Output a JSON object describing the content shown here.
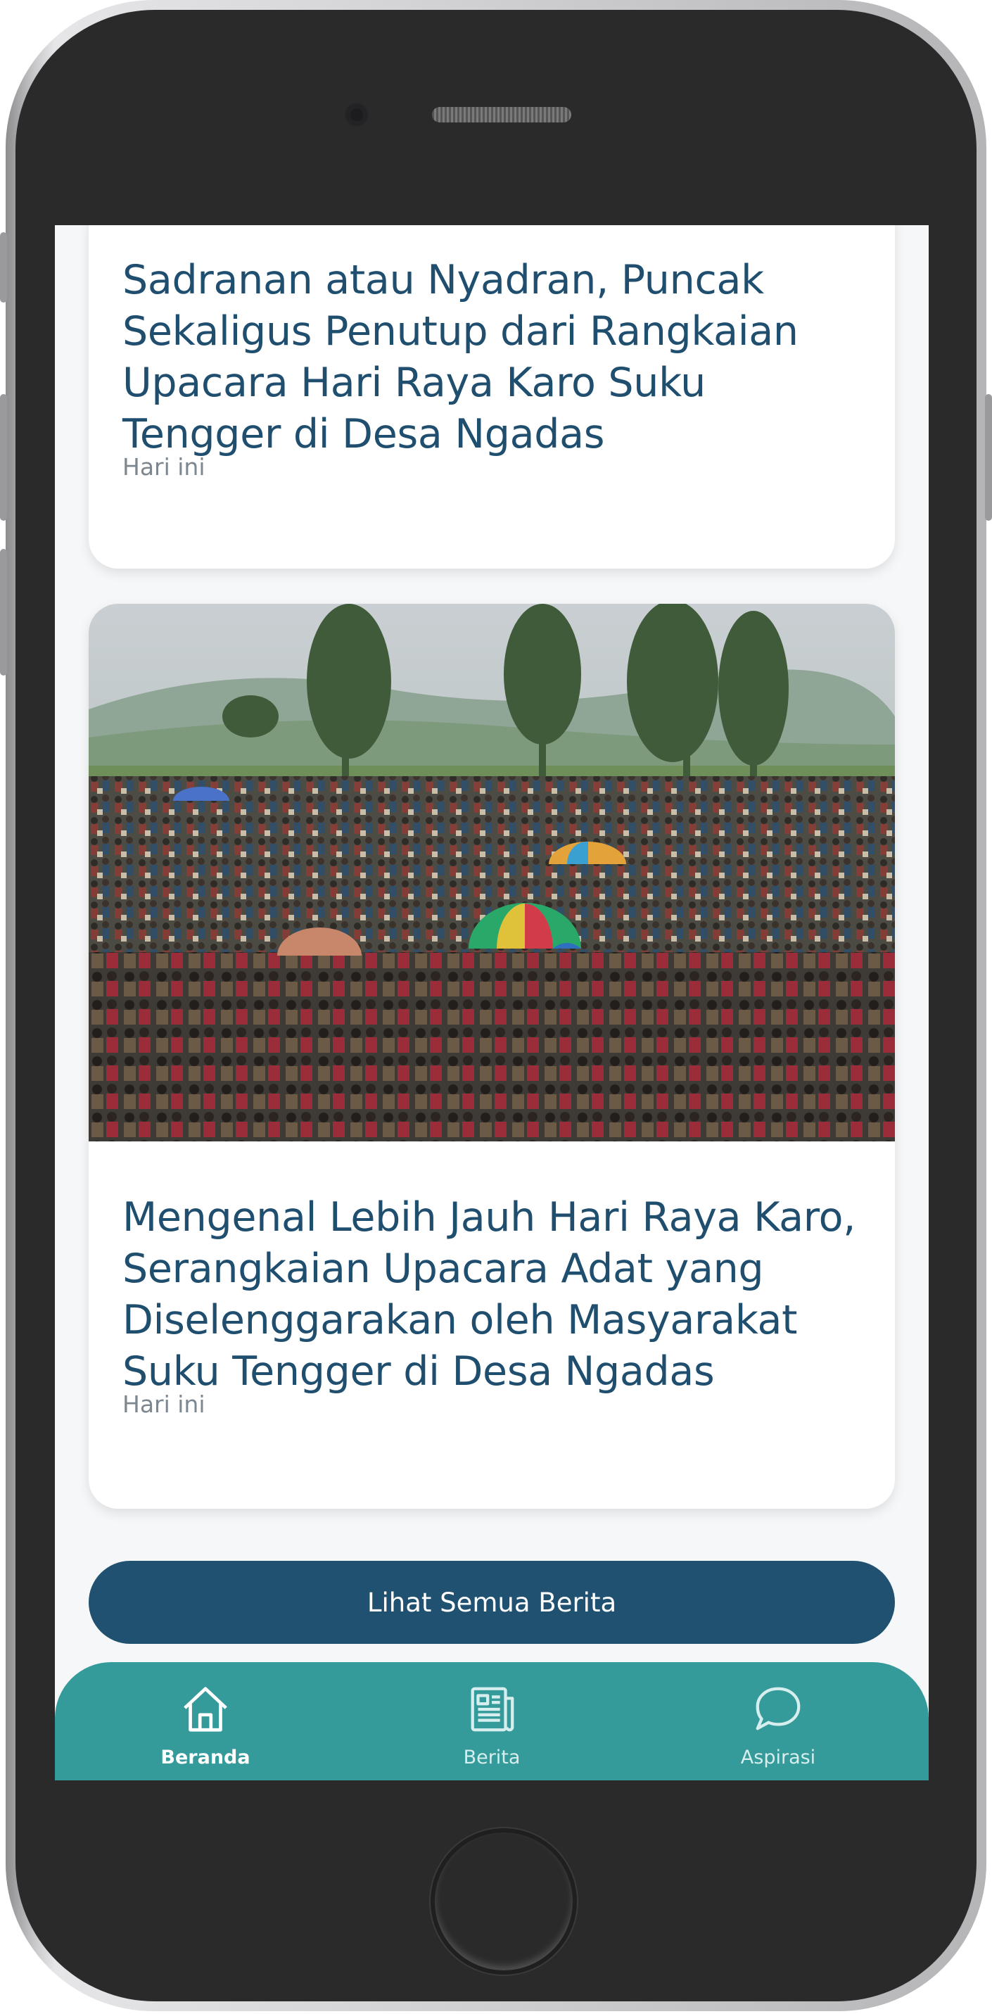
{
  "articles": [
    {
      "title": "Sadranan atau Nyadran, Puncak Sekaligus Penutup dari Rangkaian Upacara Hari Raya Karo Suku Tengger di Desa Ngadas",
      "date": "Hari ini"
    },
    {
      "title": "Mengenal Lebih Jauh Hari Raya Karo, Serangkaian Upacara Adat yang Diselenggarakan oleh Masyarakat Suku Tengger di Desa Ngadas",
      "date": "Hari ini",
      "image": "photo-crowd-ceremony-with-umbrellas"
    }
  ],
  "see_all_label": "Lihat Semua Berita",
  "nav": {
    "items": [
      {
        "label": "Beranda",
        "icon": "home-icon",
        "active": true
      },
      {
        "label": "Berita",
        "icon": "newspaper-icon",
        "active": false
      },
      {
        "label": "Aspirasi",
        "icon": "chat-bubble-icon",
        "active": false
      }
    ]
  },
  "colors": {
    "title": "#1f4e6e",
    "button": "#215171",
    "nav_bg": "#359a9a",
    "screen_bg": "#f6f7f9"
  }
}
